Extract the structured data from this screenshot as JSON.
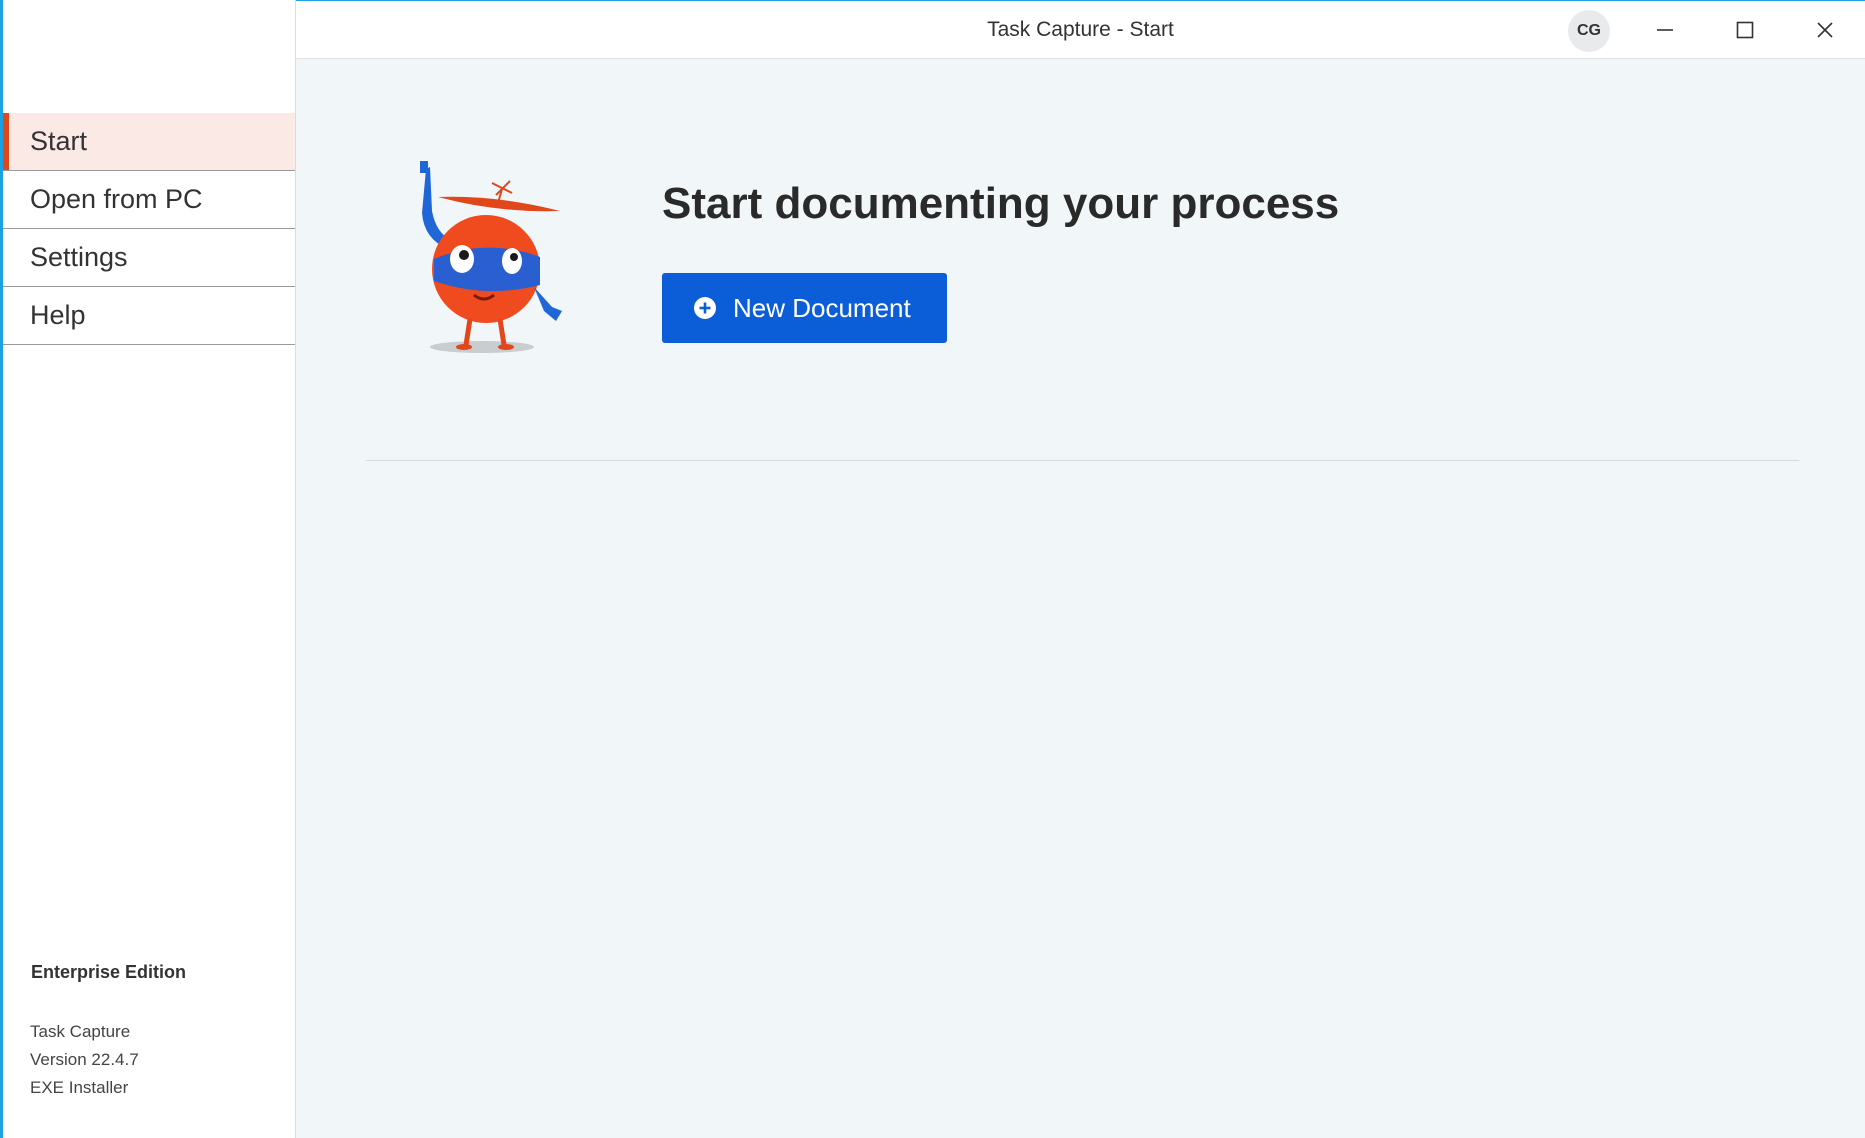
{
  "window": {
    "title": "Task Capture - Start",
    "avatar_initials": "CG"
  },
  "sidebar": {
    "items": [
      {
        "label": "Start",
        "active": true
      },
      {
        "label": "Open from PC",
        "active": false
      },
      {
        "label": "Settings",
        "active": false
      },
      {
        "label": "Help",
        "active": false
      }
    ],
    "edition": "Enterprise Edition",
    "app_name": "Task Capture",
    "version": "Version 22.4.7",
    "installer": "EXE Installer"
  },
  "main": {
    "headline": "Start documenting your process",
    "new_document_label": "New Document"
  },
  "colors": {
    "accent": "#e2461b",
    "primary_button": "#0b5ed7",
    "active_nav_bg": "#fbe9e6",
    "main_bg": "#f1f6f8"
  },
  "icons": [
    "mascot-illustration",
    "minimize-icon",
    "maximize-icon",
    "close-icon",
    "plus-circle-icon"
  ]
}
